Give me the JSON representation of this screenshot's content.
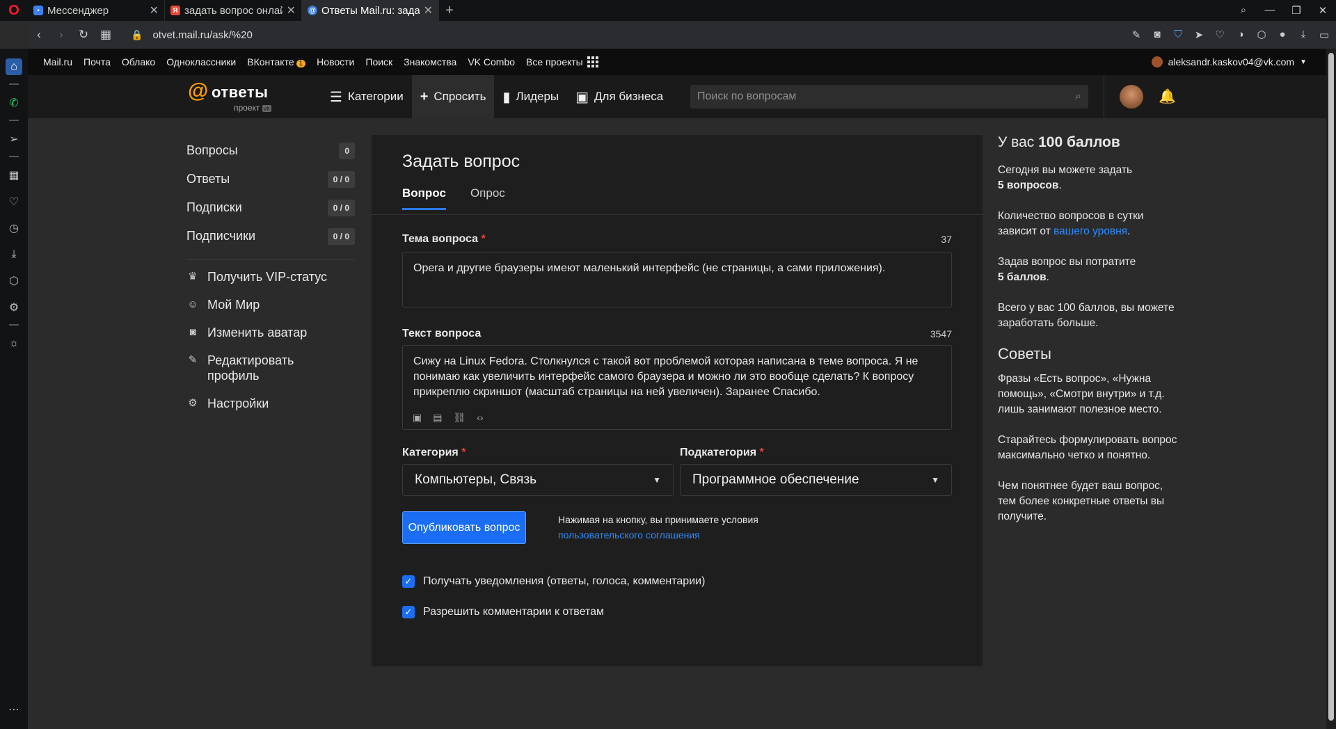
{
  "browser": {
    "tabs": [
      {
        "title": "Мессенджер",
        "favicon": "messenger-icon",
        "color": "#3b82f6"
      },
      {
        "title": "задать вопрос онлай",
        "favicon": "yandex-icon",
        "color": "#e43"
      },
      {
        "title": "Ответы Mail.ru: зада",
        "favicon": "otvety-icon",
        "color": "#3a7bd5"
      }
    ],
    "url": "otvet.mail.ru/ask/%20"
  },
  "portal": {
    "links": [
      "Mail.ru",
      "Почта",
      "Облако",
      "Одноклассники",
      "ВКонтакте",
      "Новости",
      "Поиск",
      "Знакомства",
      "VK Combo",
      "Все проекты"
    ],
    "vk_badge": "1",
    "user_email": "aleksandr.kaskov04@vk.com"
  },
  "header": {
    "logo_word": "ответы",
    "logo_sub": "проект",
    "logo_sub_mark": "vk",
    "nav": [
      {
        "label": "Категории",
        "icon": "list-icon"
      },
      {
        "label": "Спросить",
        "icon": "plus-icon"
      },
      {
        "label": "Лидеры",
        "icon": "bar-chart-icon"
      },
      {
        "label": "Для бизнеса",
        "icon": "briefcase-icon"
      }
    ],
    "search_placeholder": "Поиск по вопросам"
  },
  "leftmenu": {
    "counters": [
      {
        "label": "Вопросы",
        "count": "0"
      },
      {
        "label": "Ответы",
        "count": "0 / 0"
      },
      {
        "label": "Подписки",
        "count": "0 / 0"
      },
      {
        "label": "Подписчики",
        "count": "0 / 0"
      }
    ],
    "actions": [
      {
        "label": "Получить VIP-статус",
        "icon": "crown-icon"
      },
      {
        "label": "Мой Мир",
        "icon": "smile-icon"
      },
      {
        "label": "Изменить аватар",
        "icon": "camera-icon"
      },
      {
        "label": "Редактировать профиль",
        "icon": "user-edit-icon"
      },
      {
        "label": "Настройки",
        "icon": "gear-icon"
      }
    ]
  },
  "form": {
    "title": "Задать вопрос",
    "tabs": [
      "Вопрос",
      "Опрос"
    ],
    "subject_label": "Тема вопроса",
    "subject_count": "37",
    "subject_value": "Opera и другие браузеры имеют маленький интерфейс (не страницы, а сами приложения).",
    "text_label": "Текст вопроса",
    "text_count": "3547",
    "text_value": "Сижу на Linux Fedora. Столкнулся с такой вот проблемой которая написана в теме вопроса. Я не понимаю как увеличить интерфейс самого браузера и можно ли это вообще сделать? К вопросу прикреплю скриншот (масштаб страницы на ней увеличен). Заранее Спасибо.",
    "category_label": "Категория",
    "category_value": "Компьютеры, Связь",
    "subcategory_label": "Подкатегория",
    "subcategory_value": "Программное обеспечение",
    "publish_label": "Опубликовать вопрос",
    "terms_text": "Нажимая на кнопку, вы принимаете условия",
    "terms_link": "пользовательского соглашения",
    "chk_notify": "Получать уведомления (ответы, голоса, комментарии)",
    "chk_comments": "Разрешить комментарии к ответам",
    "required_mark": "*"
  },
  "rightinfo": {
    "points_prefix": "У вас",
    "points_value": "100 баллов",
    "today_text": "Сегодня вы можете задать",
    "today_value": "5 вопросов",
    "limit_text": "Количество вопросов в сутки зависит от",
    "limit_link": "вашего уровня",
    "cost_text": "Задав вопрос вы потратите",
    "cost_value": "5 баллов",
    "total_text": "Всего у вас 100 баллов, вы можете заработать больше.",
    "tips_title": "Советы",
    "tip1": "Фразы «Есть вопрос», «Нужна помощь», «Смотри внутри» и т.д. лишь занимают полезное место.",
    "tip2": "Старайтесь формулировать вопрос максимально четко и понятно.",
    "tip3": "Чем понятнее будет ваш вопрос, тем более конкретные ответы вы получите."
  }
}
